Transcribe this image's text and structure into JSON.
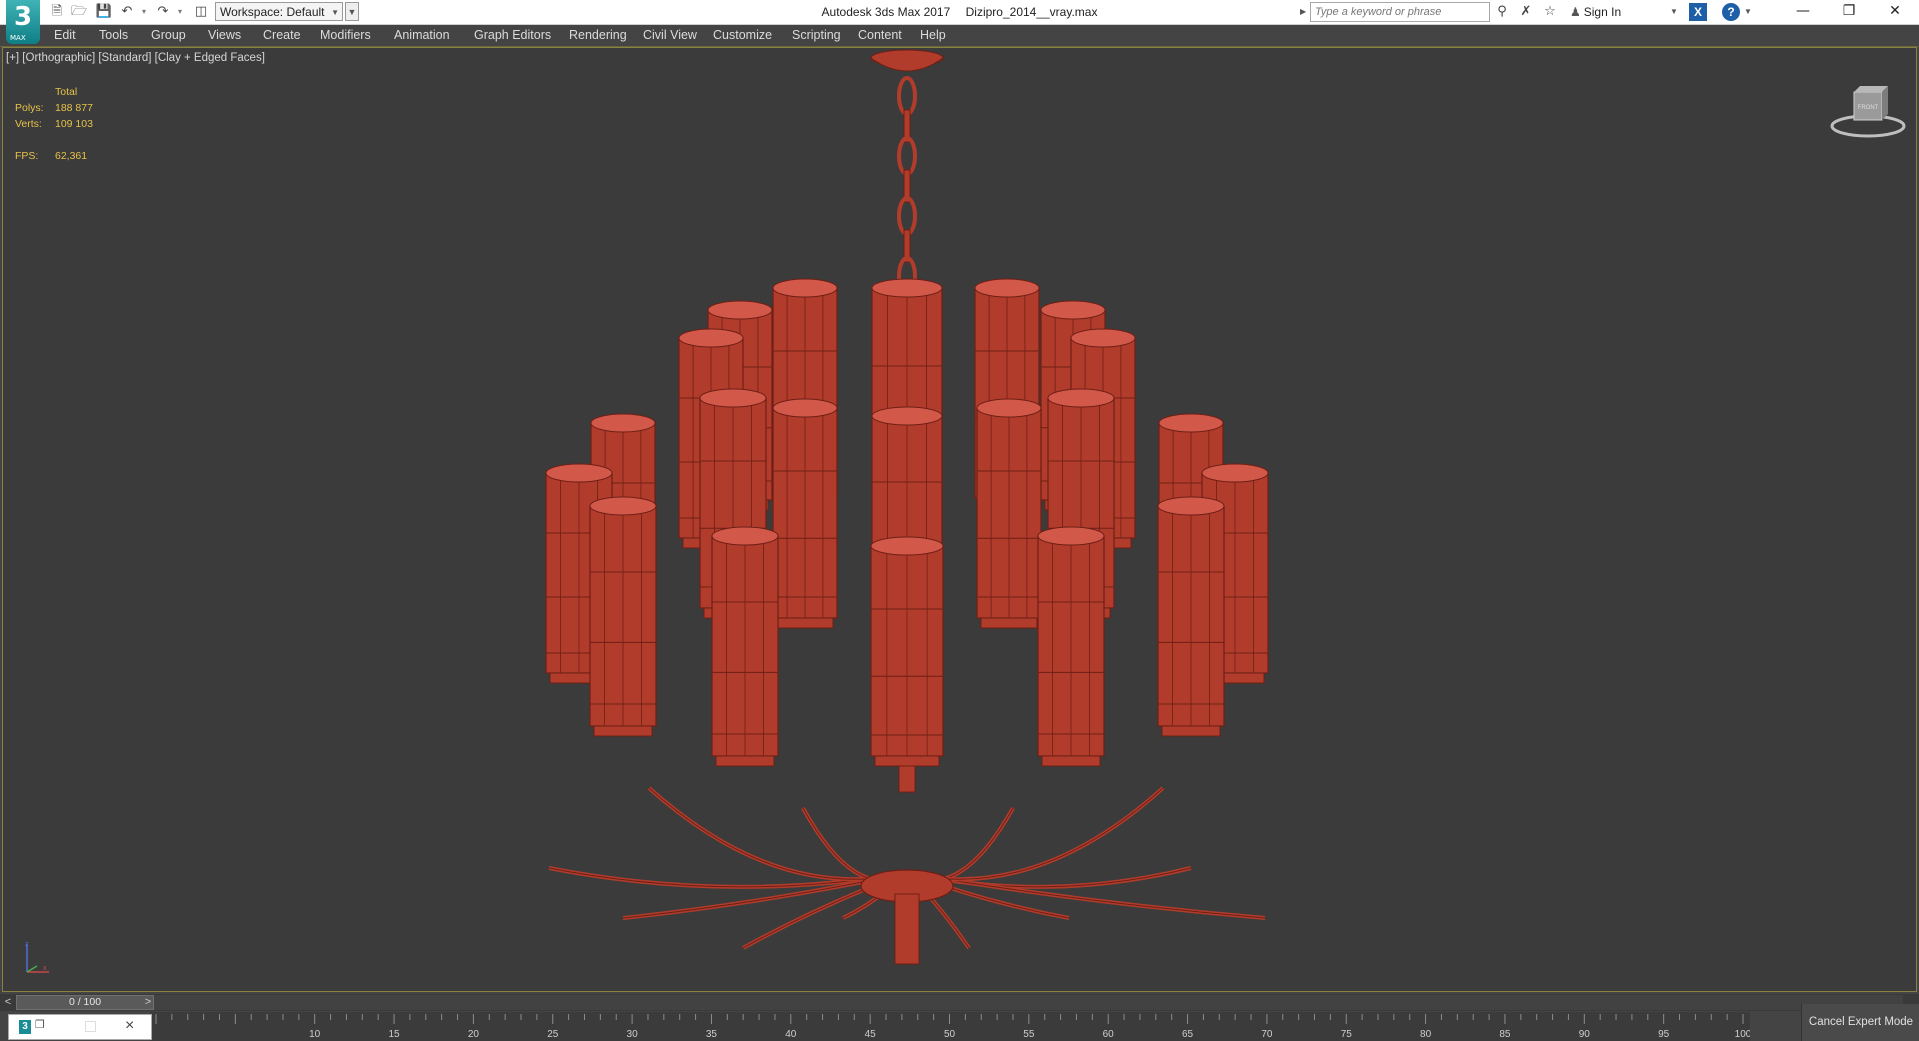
{
  "app": {
    "logo_text": "3",
    "logo_sub": "MAX",
    "name": "Autodesk 3ds Max 2017",
    "file": "Dizipro_2014__vray.max"
  },
  "quick_access": {
    "workspace_label": "Workspace: Default"
  },
  "search": {
    "placeholder": "Type a keyword or phrase"
  },
  "account": {
    "sign_in": "Sign In"
  },
  "menu": [
    "Edit",
    "Tools",
    "Group",
    "Views",
    "Create",
    "Modifiers",
    "Animation",
    "Graph Editors",
    "Rendering",
    "Civil View",
    "Customize",
    "Scripting",
    "Content",
    "Help"
  ],
  "viewport": {
    "label": "[+] [Orthographic] [Standard] [Clay + Edged Faces]",
    "stats": {
      "total_label": "Total",
      "polys_label": "Polys:",
      "polys_value": "188 877",
      "verts_label": "Verts:",
      "verts_value": "109 103",
      "fps_label": "FPS:",
      "fps_value": "62,361"
    },
    "viewcube_label": "FRONT",
    "model_color": "#b23c2c"
  },
  "timeline": {
    "prev": "<",
    "next": ">",
    "slider_text": "0 / 100",
    "current_frame": 0,
    "frame_count": 100,
    "ticks": [
      "10",
      "15",
      "20",
      "25",
      "30",
      "35",
      "40",
      "45",
      "50",
      "55",
      "60",
      "65",
      "70",
      "75",
      "80",
      "85",
      "90",
      "95",
      "100"
    ]
  },
  "status": {
    "cancel_expert": "Cancel Expert Mode"
  },
  "colors": {
    "viewport_bg": "#3b3b3b",
    "chrome_bg": "#444444",
    "stats_color": "#e6c24a",
    "active_border": "#8a8240"
  }
}
